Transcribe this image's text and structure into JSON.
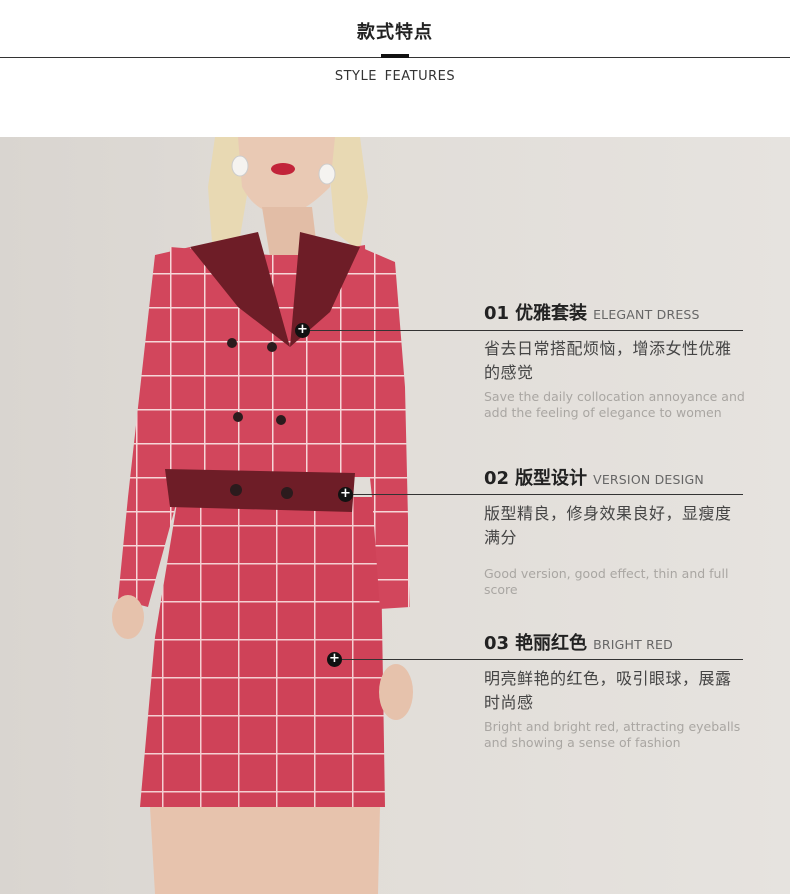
{
  "header": {
    "title_cn": "款式特点",
    "title_en": "STYLE FEATURES"
  },
  "features": [
    {
      "num": "01",
      "title_cn": "优雅套装",
      "title_en": "ELEGANT DRESS",
      "desc_cn": "省去日常搭配烦恼，增添女性优雅的感觉",
      "desc_en": "Save the daily collocation annoyance and add the feeling of elegance to women"
    },
    {
      "num": "02",
      "title_cn": "版型设计",
      "title_en": "VERSION DESIGN",
      "desc_cn": "版型精良，修身效果良好，显瘦度满分",
      "desc_en": "Good version, good effect, thin and full score"
    },
    {
      "num": "03",
      "title_cn": "艳丽红色",
      "title_en": "BRIGHT RED",
      "desc_cn": "明亮鲜艳的红色，吸引眼球，展露时尚感",
      "desc_en": "Bright and bright red, attracting eyeballs and showing a sense of fashion"
    }
  ],
  "colors": {
    "suit_red": "#d2465c",
    "collar_burgundy": "#6e1d27",
    "grid_line": "#f6d6d8",
    "background": "#e0dcd7"
  },
  "icons": [
    "plus-icon"
  ]
}
